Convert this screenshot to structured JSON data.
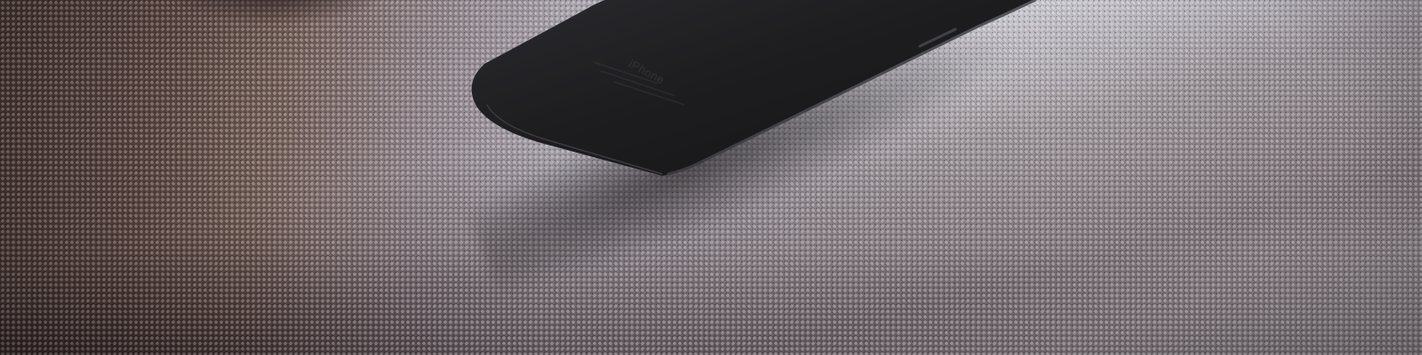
{
  "photo": {
    "subject": "smartphone",
    "phone_engraving": "iPhone",
    "colors": {
      "phone_body": "#1d1d20",
      "fabric_light": "#c3c2cb",
      "fabric_dark": "#5c4540"
    }
  }
}
